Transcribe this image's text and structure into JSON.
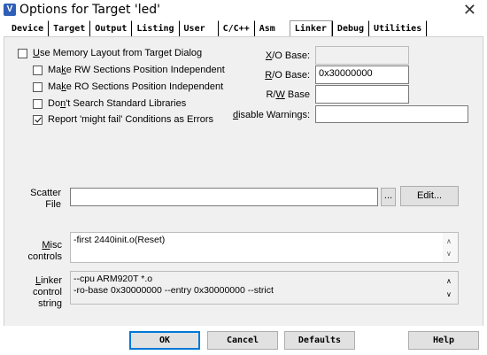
{
  "window": {
    "title": "Options for Target 'led'",
    "icon_glyph": "V"
  },
  "tabs": [
    {
      "label": "Device"
    },
    {
      "label": "Target"
    },
    {
      "label": "Output"
    },
    {
      "label": "Listing"
    },
    {
      "label": "User"
    },
    {
      "label": "C/C++"
    },
    {
      "label": "Asm"
    },
    {
      "label": "Linker"
    },
    {
      "label": "Debug"
    },
    {
      "label": "Utilities"
    }
  ],
  "active_tab": "Linker",
  "options": {
    "use_memory_layout": {
      "pre": "",
      "ul": "U",
      "post": "se Memory Layout from Target Dialog",
      "checked": false
    },
    "rw_independent": {
      "pre": "Ma",
      "ul": "k",
      "post": "e RW Sections Position Independent",
      "checked": false
    },
    "ro_independent": {
      "pre": "Ma",
      "ul": "k",
      "post": "e RO Sections Position Independent",
      "checked": false
    },
    "no_std_libs": {
      "pre": "Do",
      "ul": "n",
      "post": "'t Search Standard Libraries",
      "checked": false
    },
    "might_fail": {
      "pre": "",
      "ul": "",
      "post": "Report 'might fail' Conditions as Errors",
      "checked": true
    }
  },
  "fields": {
    "xo_base": {
      "ul": "X",
      "rest": "/O Base:",
      "value": ""
    },
    "ro_base": {
      "ul": "R",
      "rest": "/O Base:",
      "value": "0x30000000"
    },
    "rw_base": {
      "pre": "R/",
      "ul": "W",
      "rest": " Base",
      "value": ""
    },
    "disable_warnings": {
      "ul": "d",
      "rest": "isable Warnings:",
      "value": ""
    }
  },
  "scatter": {
    "label_line1": "Scatter",
    "label_line2": "File",
    "value": "",
    "browse_label": "...",
    "edit_label": "Edit..."
  },
  "misc": {
    "ul": "M",
    "rest": "isc",
    "line2": "controls",
    "value": "-first 2440init.o(Reset)"
  },
  "linker": {
    "ul": "L",
    "rest": "inker",
    "line2": "control",
    "line3": "string",
    "lines": [
      "--cpu ARM920T *.o",
      "-ro-base 0x30000000 --entry 0x30000000 --strict"
    ]
  },
  "buttons": {
    "ok": "OK",
    "cancel": "Cancel",
    "defaults": "Defaults",
    "help": "Help"
  },
  "colors": {
    "accent": "#0078d7",
    "panel": "#f0f0f0"
  }
}
